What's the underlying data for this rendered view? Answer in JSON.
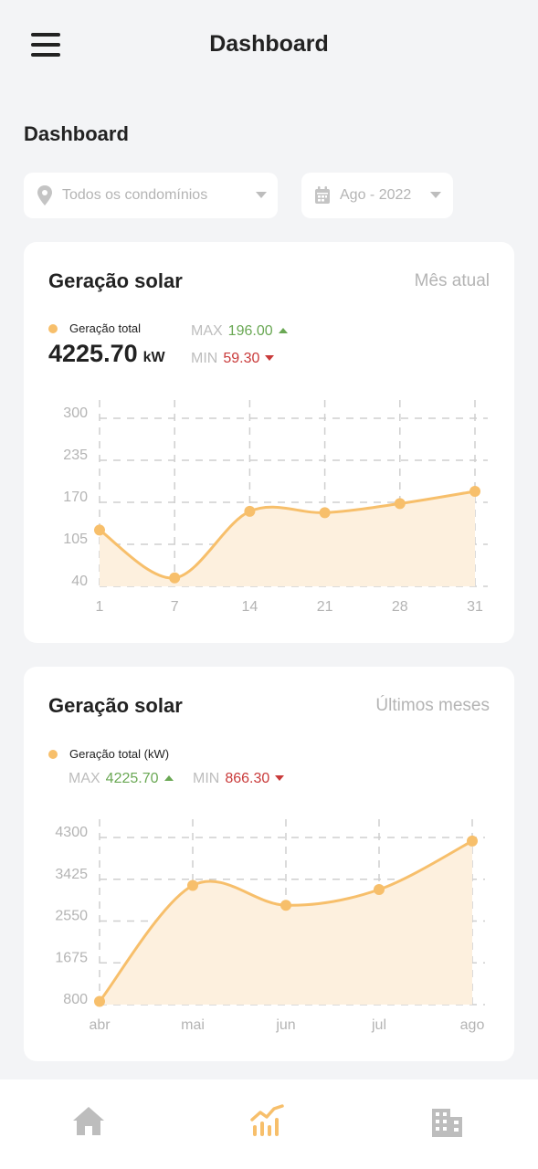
{
  "app": {
    "title": "Dashboard"
  },
  "page": {
    "section_title": "Dashboard"
  },
  "filters": {
    "condominium": {
      "value": "Todos os condomínios",
      "icon": "map-pin-icon"
    },
    "period": {
      "value": "Ago - 2022",
      "icon": "calendar-icon"
    }
  },
  "card_monthly": {
    "title": "Geração solar",
    "period_label": "Mês atual",
    "legend": "Geração total",
    "total_value": "4225.70",
    "total_unit": "kW",
    "max_label": "MAX",
    "max_value": "196.00",
    "min_label": "MIN",
    "min_value": "59.30"
  },
  "card_history": {
    "title": "Geração solar",
    "period_label": "Últimos meses",
    "legend": "Geração total (kW)",
    "max_label": "MAX",
    "max_value": "4225.70",
    "min_label": "MIN",
    "min_value": "866.30"
  },
  "bottom_nav": {
    "items": [
      {
        "icon": "home-icon",
        "active": false
      },
      {
        "icon": "chart-icon",
        "active": true
      },
      {
        "icon": "building-icon",
        "active": false
      }
    ]
  },
  "colors": {
    "accent": "#f7bf6b",
    "accent_fill": "#fdf0de",
    "positive": "#6aa854",
    "negative": "#c93a3a",
    "nav_inactive": "#bdbdbd"
  },
  "chart_data": [
    {
      "type": "area",
      "title": "Geração solar",
      "x": [
        "1",
        "7",
        "14",
        "21",
        "28",
        "31"
      ],
      "series": [
        {
          "name": "Geração total",
          "values": [
            127,
            53,
            156,
            154,
            168,
            187
          ]
        }
      ],
      "yticks": [
        40,
        105,
        170,
        235,
        300
      ],
      "ylim": [
        40,
        300
      ],
      "grid": true,
      "legend": "top-left"
    },
    {
      "type": "area",
      "title": "Geração solar",
      "x": [
        "abr",
        "mai",
        "jun",
        "jul",
        "ago"
      ],
      "series": [
        {
          "name": "Geração total (kW)",
          "values": [
            866.3,
            3295,
            2880,
            3210,
            4225.7
          ]
        }
      ],
      "yticks": [
        800,
        1675,
        2550,
        3425,
        4300
      ],
      "ylim": [
        800,
        4300
      ],
      "grid": true,
      "legend": "top-left"
    }
  ]
}
